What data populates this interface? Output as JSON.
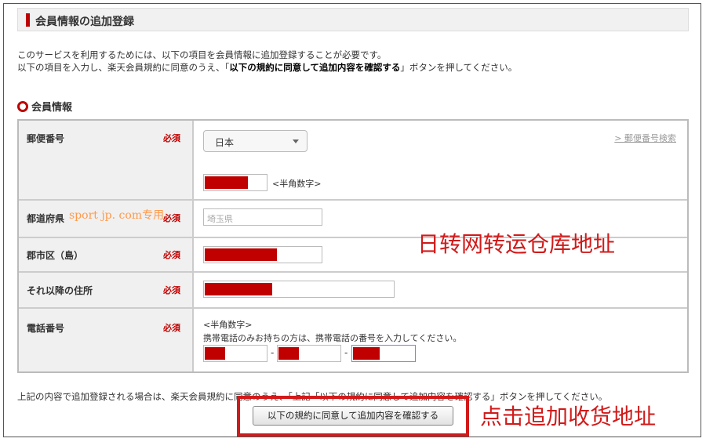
{
  "page": {
    "title": "会員情報の追加登録",
    "intro_line1": "このサービスを利用するためには、以下の項目を会員情報に追加登録することが必要です。",
    "intro_line2_pre": "以下の項目を入力し、楽天会員規約に同意のうえ、「",
    "intro_line2_bold": "以下の規約に同意して追加内容を確認する",
    "intro_line2_post": "」ボタンを押してください。",
    "section_title": "会員情報"
  },
  "form": {
    "required_label": "必須",
    "postal": {
      "label": "郵便番号",
      "country_selected": "日本",
      "search_link": "> 郵便番号検索",
      "hint": "<半角数字>"
    },
    "prefecture": {
      "label": "都道府県",
      "placeholder": "埼玉県"
    },
    "city": {
      "label": "郡市区（島）"
    },
    "address": {
      "label": "それ以降の住所"
    },
    "phone": {
      "label": "電話番号",
      "hint1": "<半角数字>",
      "hint2": "携帯電話のみお持ちの方は、携帯電話の番号を入力してください。",
      "separator": "-"
    }
  },
  "footer": {
    "text": "上記の内容で追加登録される場合は、楽天会員規約に同意のうえ、「上記「以下の規約に同意して追加内容を確認する」ボタンを押してください。",
    "confirm_button": "以下の規約に同意して追加内容を確認する"
  },
  "overlays": {
    "watermark": "sport jp. com专用",
    "annotation_address": "日转网转运仓库地址",
    "annotation_click": "点击追加收货地址",
    "annotation_color": "#d11a1a",
    "redaction_color": "#c00000"
  }
}
